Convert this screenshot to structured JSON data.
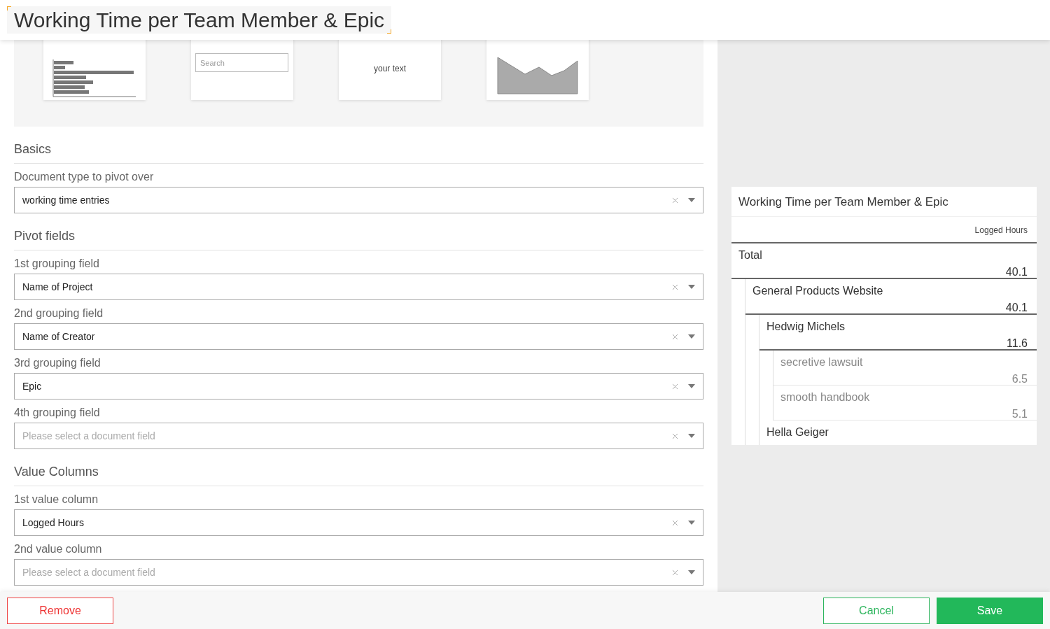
{
  "title": "Working Time per Team Member & Epic",
  "widgets": [
    {
      "kind": "row_chart"
    },
    {
      "kind": "search_bar",
      "placeholder": "Search"
    },
    {
      "kind": "spacer",
      "text": "your text"
    },
    {
      "kind": "timeline_chart"
    }
  ],
  "sections": [
    {
      "heading": "Basics",
      "fields": [
        {
          "label": "Document type to pivot over",
          "value": "working time entries"
        }
      ]
    },
    {
      "heading": "Pivot fields",
      "fields": [
        {
          "label": "1st grouping field",
          "value": "Name of Project"
        },
        {
          "label": "2nd grouping field",
          "value": "Name of Creator"
        },
        {
          "label": "3rd grouping field",
          "value": "Epic"
        },
        {
          "label": "4th grouping field",
          "placeholder": "Please select a document field"
        }
      ]
    },
    {
      "heading": "Value Columns",
      "fields": [
        {
          "label": "1st value column",
          "value": "Logged Hours"
        },
        {
          "label": "2nd value column",
          "placeholder": "Please select a document field"
        }
      ]
    }
  ],
  "preview": {
    "title": "Working Time per Team Member & Epic",
    "column": "Logged Hours",
    "rows": [
      {
        "label": "Total",
        "value": "40.1",
        "children": [
          {
            "label": "General Products Website",
            "value": "40.1",
            "children": [
              {
                "label": "Hedwig Michels",
                "value": "11.6",
                "children": [
                  {
                    "label": "secretive lawsuit",
                    "value": "6.5"
                  },
                  {
                    "label": "smooth handbook",
                    "value": "5.1"
                  }
                ]
              },
              {
                "label": "Hella Geiger"
              }
            ]
          }
        ]
      }
    ]
  },
  "buttons": [
    {
      "kind": "remove",
      "label": "Remove"
    },
    {
      "kind": "cancel",
      "label": "Cancel"
    },
    {
      "kind": "save",
      "label": "Save"
    }
  ]
}
